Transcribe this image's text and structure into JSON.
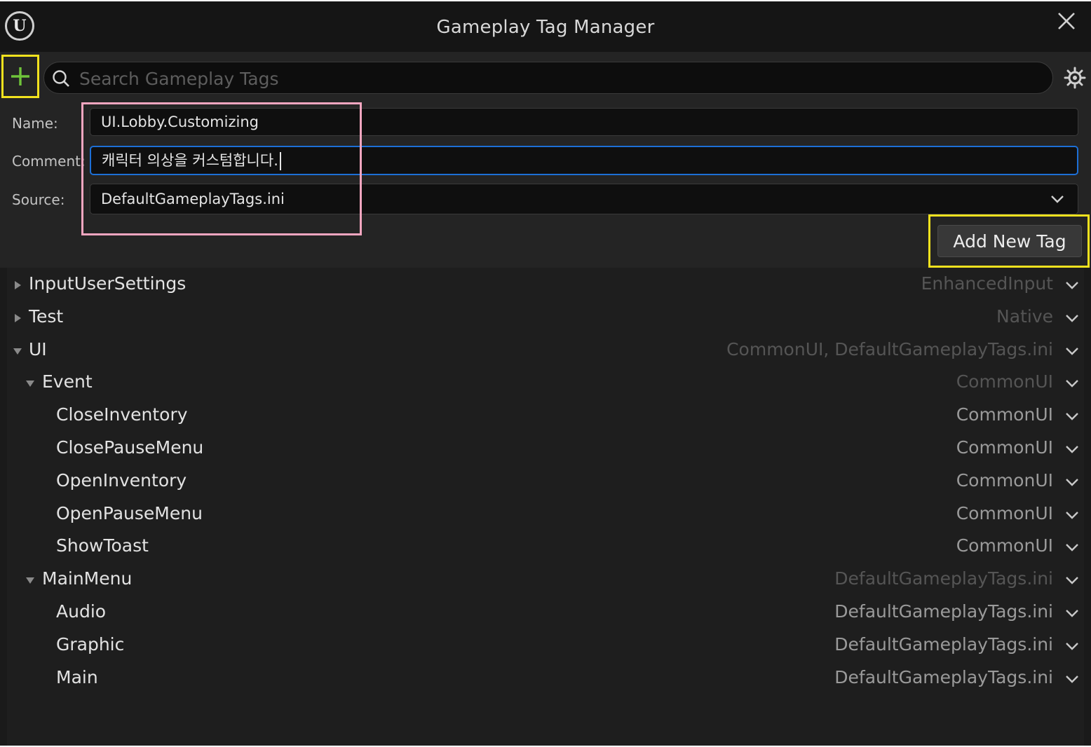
{
  "window": {
    "title": "Gameplay Tag Manager"
  },
  "toolbar": {
    "search_placeholder": "Search Gameplay Tags"
  },
  "form": {
    "name_label": "Name:",
    "name_value": "UI.Lobby.Customizing",
    "comment_label": "Comment:",
    "comment_value": "캐릭터 의상을 커스텀합니다.",
    "source_label": "Source:",
    "source_value": "DefaultGameplayTags.ini",
    "add_button_label": "Add New Tag"
  },
  "tree": {
    "rows": [
      {
        "label": "InputUserSettings",
        "source": "EnhancedInput",
        "depth": 0,
        "expander": "collapsed",
        "source_dim": true
      },
      {
        "label": "Test",
        "source": "Native",
        "depth": 0,
        "expander": "collapsed",
        "source_dim": true
      },
      {
        "label": "UI",
        "source": "CommonUI, DefaultGameplayTags.ini",
        "depth": 0,
        "expander": "expanded",
        "source_dim": true
      },
      {
        "label": "Event",
        "source": "CommonUI",
        "depth": 1,
        "expander": "expanded",
        "source_dim": true
      },
      {
        "label": "CloseInventory",
        "source": "CommonUI",
        "depth": 2,
        "expander": "none",
        "source_dim": false
      },
      {
        "label": "ClosePauseMenu",
        "source": "CommonUI",
        "depth": 2,
        "expander": "none",
        "source_dim": false
      },
      {
        "label": "OpenInventory",
        "source": "CommonUI",
        "depth": 2,
        "expander": "none",
        "source_dim": false
      },
      {
        "label": "OpenPauseMenu",
        "source": "CommonUI",
        "depth": 2,
        "expander": "none",
        "source_dim": false
      },
      {
        "label": "ShowToast",
        "source": "CommonUI",
        "depth": 2,
        "expander": "none",
        "source_dim": false
      },
      {
        "label": "MainMenu",
        "source": "DefaultGameplayTags.ini",
        "depth": 1,
        "expander": "expanded",
        "source_dim": true
      },
      {
        "label": "Audio",
        "source": "DefaultGameplayTags.ini",
        "depth": 2,
        "expander": "none",
        "source_dim": false
      },
      {
        "label": "Graphic",
        "source": "DefaultGameplayTags.ini",
        "depth": 2,
        "expander": "none",
        "source_dim": false
      },
      {
        "label": "Main",
        "source": "DefaultGameplayTags.ini",
        "depth": 2,
        "expander": "none",
        "source_dim": false
      }
    ]
  },
  "colors": {
    "highlight_yellow": "#f2e21e",
    "highlight_pink": "#f4a6c0",
    "plus_green": "#6fc43a",
    "focus_blue": "#1d6fd6"
  }
}
